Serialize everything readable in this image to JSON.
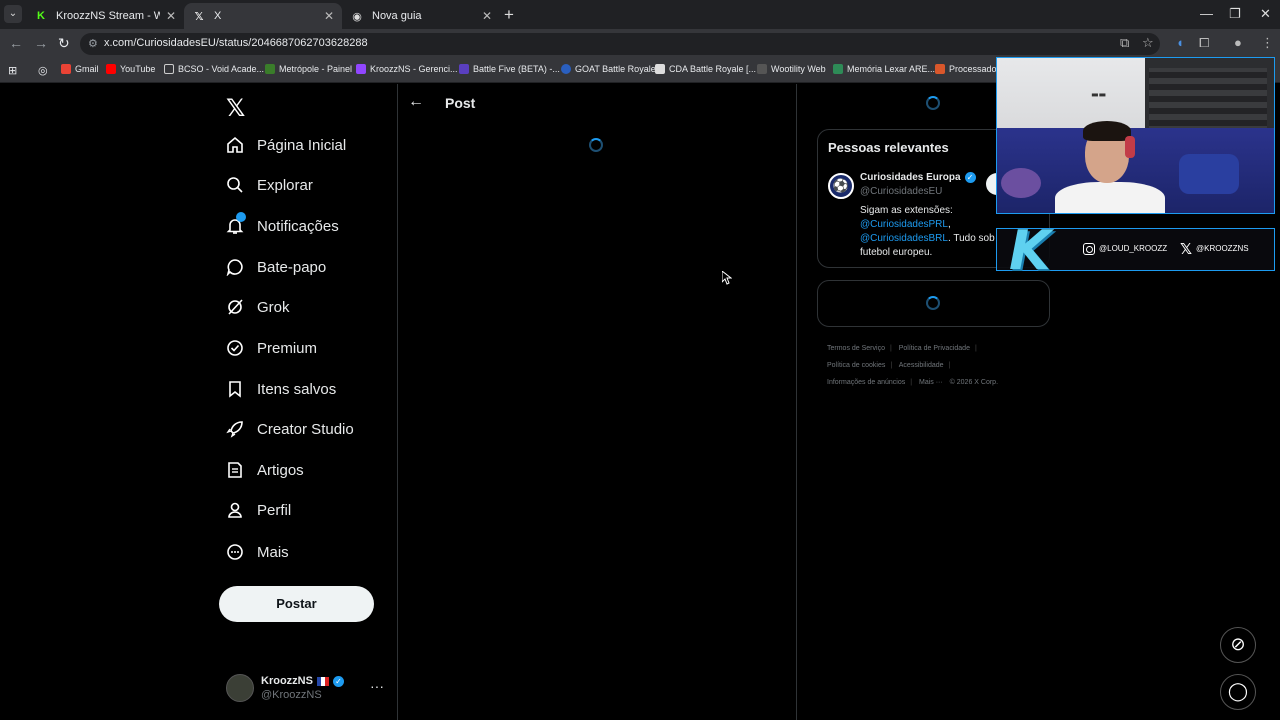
{
  "browser": {
    "tabs": [
      {
        "title": "KroozzNS Stream - Watch Live",
        "icon": "kick-icon",
        "active": false
      },
      {
        "title": "X",
        "icon": "x-icon",
        "active": true
      },
      {
        "title": "Nova guia",
        "icon": "chrome-icon",
        "active": false
      }
    ],
    "url": "x.com/CuriosidadesEU/status/2046687062703628288",
    "bookmarks": [
      {
        "label": "Gmail"
      },
      {
        "label": "YouTube"
      },
      {
        "label": "BCSO - Void Acade..."
      },
      {
        "label": "Metrópole - Painel"
      },
      {
        "label": "KroozzNS - Gerenci..."
      },
      {
        "label": "Battle Five (BETA) -..."
      },
      {
        "label": "GOAT Battle Royale"
      },
      {
        "label": "CDA Battle Royale [..."
      },
      {
        "label": "Wootility Web"
      },
      {
        "label": "Memória Lexar ARE..."
      },
      {
        "label": "Processador"
      }
    ]
  },
  "sidebar": {
    "items": [
      {
        "label": "Página Inicial",
        "icon": "home-icon"
      },
      {
        "label": "Explorar",
        "icon": "search-icon"
      },
      {
        "label": "Notificações",
        "icon": "bell-icon"
      },
      {
        "label": "Bate-papo",
        "icon": "chat-icon"
      },
      {
        "label": "Grok",
        "icon": "grok-icon"
      },
      {
        "label": "Premium",
        "icon": "premium-icon"
      },
      {
        "label": "Itens salvos",
        "icon": "bookmark-icon"
      },
      {
        "label": "Creator Studio",
        "icon": "rocket-icon"
      },
      {
        "label": "Artigos",
        "icon": "article-icon"
      },
      {
        "label": "Perfil",
        "icon": "person-icon"
      },
      {
        "label": "Mais",
        "icon": "more-circle-icon"
      }
    ],
    "post_button": "Postar",
    "account": {
      "name": "KroozzNS",
      "handle": "@KroozzNS"
    }
  },
  "main": {
    "title": "Post"
  },
  "right": {
    "relevant_title": "Pessoas relevantes",
    "person": {
      "name": "Curiosidades Europa",
      "handle": "@CuriosidadesEU",
      "bio_1": "Sigam as extensões:",
      "bio_link1": "@CuriosidadesPRL",
      "bio_after1": ",",
      "bio_link2": "@CuriosidadesBRL",
      "bio_after2": ". Tudo sob",
      "bio_3": "futebol europeu."
    },
    "footer": {
      "terms": "Termos de Serviço",
      "privacy": "Política de Privacidade",
      "cookies": "Política de cookies",
      "accessibility": "Acessibilidade",
      "ads": "Informações de anúncios",
      "more": "Mais ···",
      "copyright": "© 2026 X Corp."
    }
  },
  "overlay": {
    "instagram": "@LOUD_KROOZZ",
    "x_handle": "@KROOZZNS"
  },
  "colors": {
    "accent": "#1d9bf0",
    "background": "#000000"
  }
}
